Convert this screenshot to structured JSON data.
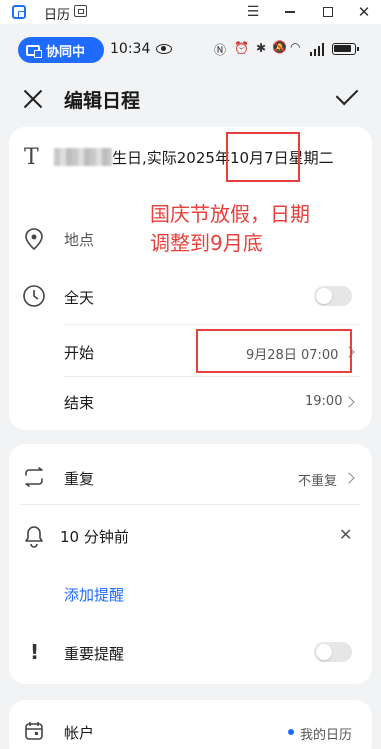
{
  "window": {
    "title": "日历",
    "controls": [
      "menu",
      "minimize",
      "maximize",
      "close"
    ]
  },
  "status_bar": {
    "collab_label": "协同中",
    "time": "10:34"
  },
  "header": {
    "title": "编辑日程"
  },
  "event": {
    "title_visible": "生日,实际2025年10月7日星期二",
    "location_placeholder": "地点",
    "all_day_label": "全天",
    "all_day_on": false,
    "start_label": "开始",
    "start_value": "9月28日 07:00",
    "end_label": "结束",
    "end_value": "19:00"
  },
  "annotation": {
    "text_line1": "国庆节放假，日期",
    "text_line2": "调整到9月底",
    "color": "#e8403a"
  },
  "options": {
    "repeat_label": "重复",
    "repeat_value": "不重复",
    "reminder_label": "10 分钟前",
    "add_reminder_label": "添加提醒",
    "important_label": "重要提醒",
    "important_on": false,
    "account_label": "帐户",
    "account_value": "我的日历"
  },
  "colors": {
    "accent": "#1f6bff",
    "background": "#f1f3f5",
    "annotation": "#e8403a"
  }
}
